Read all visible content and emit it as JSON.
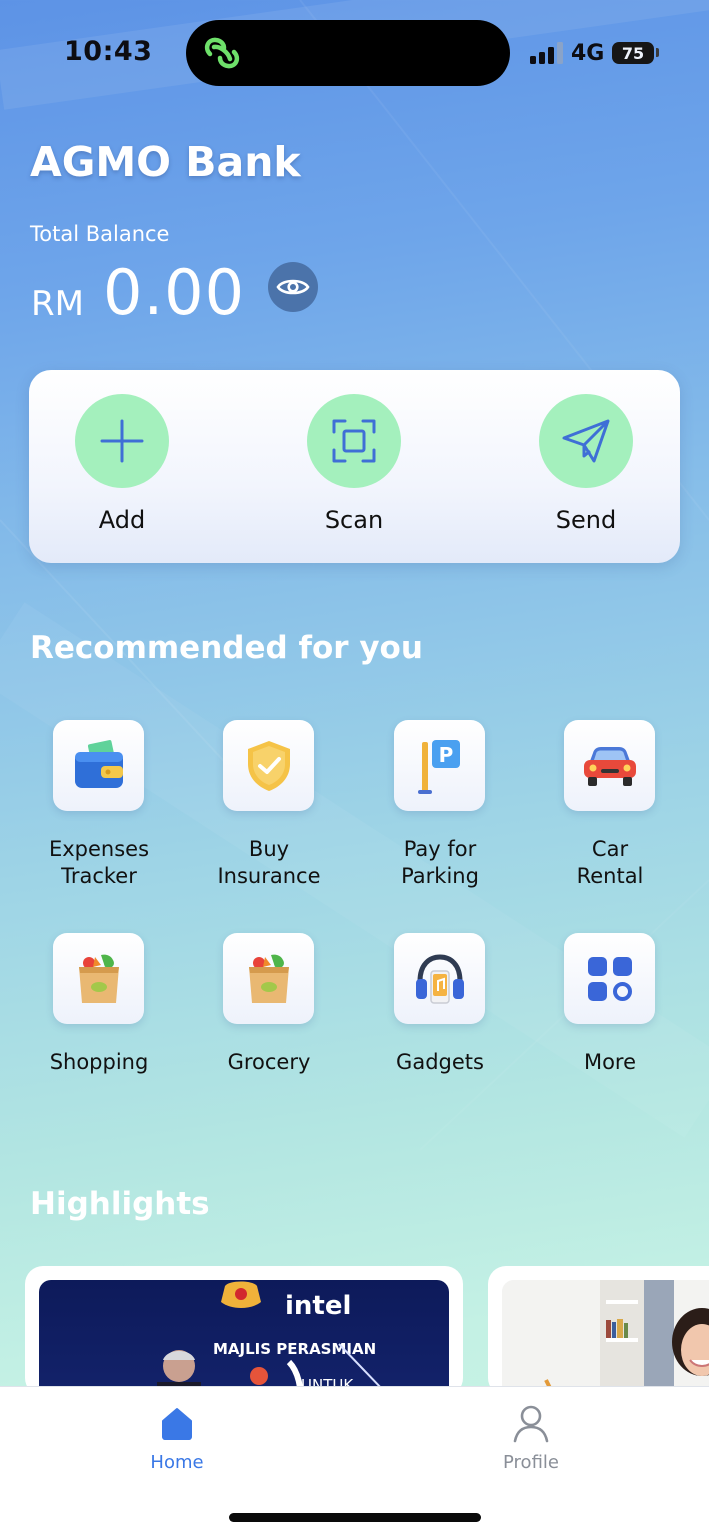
{
  "status_bar": {
    "time": "10:43",
    "network": "4G",
    "battery": "75",
    "island_icon": "link-chain-icon"
  },
  "header": {
    "bank_name": "AGMO Bank",
    "balance_label": "Total Balance",
    "currency": "RM",
    "amount": "0.00",
    "toggle_icon": "eye-icon"
  },
  "actions": [
    {
      "label": "Add",
      "icon": "plus-icon"
    },
    {
      "label": "Scan",
      "icon": "scan-frame-icon"
    },
    {
      "label": "Send",
      "icon": "paper-plane-icon"
    }
  ],
  "recommended": {
    "title": "Recommended for you",
    "items": [
      {
        "label": "Expenses\nTracker",
        "icon": "wallet-icon"
      },
      {
        "label": "Buy\nInsurance",
        "icon": "shield-check-icon"
      },
      {
        "label": "Pay for\nParking",
        "icon": "parking-sign-icon"
      },
      {
        "label": "Car\nRental",
        "icon": "car-icon"
      },
      {
        "label": "Shopping",
        "icon": "grocery-bag-icon"
      },
      {
        "label": "Grocery",
        "icon": "grocery-bag-icon"
      },
      {
        "label": "Gadgets",
        "icon": "headphones-icon"
      },
      {
        "label": "More",
        "icon": "grid-more-icon"
      }
    ]
  },
  "highlights": {
    "title": "Highlights",
    "card1_texts": [
      "intel",
      "MAJLIS PERASMIAN"
    ]
  },
  "bottom_nav": [
    {
      "label": "Home",
      "icon": "home-icon",
      "active": true
    },
    {
      "label": "Profile",
      "icon": "person-icon",
      "active": false
    }
  ],
  "colors": {
    "accent": "#3a78e6",
    "action_circle": "#a4f0bd",
    "icon_blue": "#3f6fd6",
    "nav_inactive": "#8a8f98"
  }
}
